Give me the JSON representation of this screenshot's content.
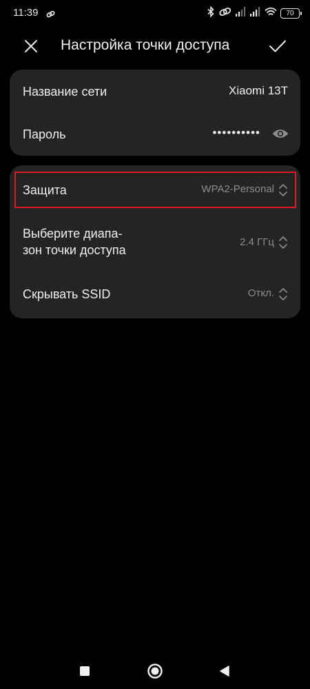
{
  "status_bar": {
    "time": "11:39",
    "battery": "70",
    "icons": [
      "link-icon",
      "bluetooth-icon",
      "hotspot-icon",
      "signal-icon",
      "signal-icon",
      "wifi-icon",
      "battery-icon"
    ]
  },
  "header": {
    "title": "Настройка точки доступа",
    "close_icon": "close-icon",
    "confirm_icon": "checkmark-icon"
  },
  "network_card": {
    "name_label": "Название сети",
    "name_value": "Xiaomi 13T",
    "password_label": "Пароль",
    "password_value": "••••••••••",
    "password_icon": "eye-icon"
  },
  "settings_card": {
    "security_label": "Защита",
    "security_value": "WPA2-Personal",
    "band_label_line1": "Выберите диапа-",
    "band_label_line2": "зон точки доступа",
    "band_value": "2.4 ГГц",
    "hide_ssid_label": "Скрывать SSID",
    "hide_ssid_value": "Откл."
  },
  "nav_bar": {
    "icons": [
      "recents-icon",
      "home-icon",
      "back-icon"
    ]
  },
  "colors": {
    "background": "#000000",
    "card": "#242424",
    "highlight": "#e01b24",
    "secondary_text": "#8d8d8d"
  }
}
